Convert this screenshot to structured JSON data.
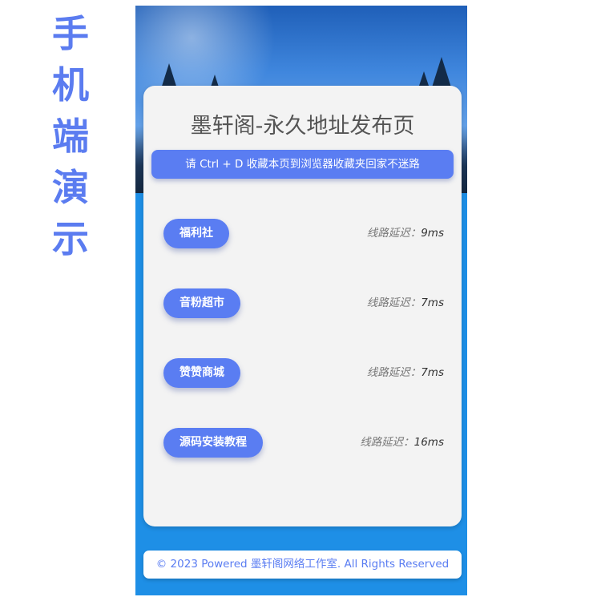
{
  "side_label": [
    "手",
    "机",
    "端",
    "演",
    "示"
  ],
  "page": {
    "title": "墨轩阁-永久地址发布页",
    "notice": "请 Ctrl + D 收藏本页到浏览器收藏夹回家不迷路"
  },
  "latency_label": "线路延迟：",
  "sites": [
    {
      "name": "福利社",
      "latency": "9ms"
    },
    {
      "name": "音粉超市",
      "latency": "7ms"
    },
    {
      "name": "赞赞商城",
      "latency": "7ms"
    },
    {
      "name": "源码安装教程",
      "latency": "16ms"
    }
  ],
  "footer": "© 2023 Powered 墨轩阁网络工作室. All Rights Reserved",
  "colors": {
    "accent": "#5a7df2",
    "side_label": "#5b7cf0",
    "card_bg": "#f3f3f3",
    "phone_bg": "#1e8fe6"
  }
}
